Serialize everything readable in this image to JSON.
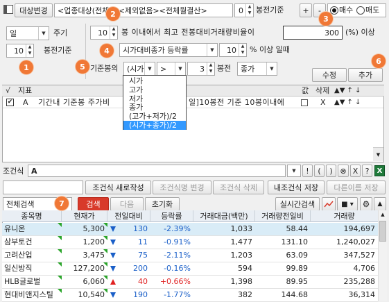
{
  "toolbar": {
    "target_change_label": "대상변경",
    "filter_text": "<업종대상(전체)><제외없음><전체월결산>",
    "bong_value": "0",
    "bong_label": "봉전기준",
    "plus_label": "+",
    "minus_label": "-",
    "buy_label": "매수",
    "sell_label": "매도",
    "side_selected": "buy"
  },
  "left_panel": {
    "period_value": "일",
    "period_label": "주기",
    "base_value": "10",
    "base_label": "봉전기준"
  },
  "condition": {
    "bong_count": "10",
    "line1_text": "봉 이내에서 최고 전봉대비거래량비율이",
    "ratio_value": "300",
    "ratio_unit": "(%) 이상",
    "compare_select": "시가대비종가 등락률",
    "pct_value": "10",
    "pct_label": "% 이상 일때",
    "base_bong_label": "기준봉의",
    "base_bong_select": "(시가",
    "op_select": ">",
    "bong_num": "3",
    "bong_suffix": "봉전",
    "price_select": "종가"
  },
  "dropdown": {
    "options": [
      "시가",
      "고가",
      "저가",
      "종가",
      "(고가+저가)/2",
      "(시가+종가)/2"
    ],
    "highlighted_index": 5
  },
  "actions": {
    "modify_label": "수정",
    "add_label": "추가"
  },
  "grid": {
    "headers": [
      "√",
      "지표",
      "값",
      "삭제"
    ],
    "row": {
      "key": "A",
      "text": "기간내 기준봉 주가비",
      "text_tail": "일]10봉전 기준 10봉이내에",
      "value_mark": "X"
    }
  },
  "formula": {
    "label": "조건식",
    "value": "A",
    "ops": [
      "!",
      "(",
      ")",
      "⊗",
      "X",
      "?"
    ]
  },
  "bottom_buttons": {
    "new_label": "조건식 새로작성",
    "rename_label": "조건식명 변경",
    "delete_label": "조건식 삭제",
    "my_save_label": "내조건식 저장",
    "save_as_label": "다른이름 저장"
  },
  "search_bar": {
    "scope_value": "전체검색",
    "search_label": "검색",
    "next_label": "다음",
    "reset_label": "초기화",
    "realtime_label": "실시간검색"
  },
  "badges": [
    "1",
    "2",
    "3",
    "4",
    "5",
    "6",
    "7"
  ],
  "results": {
    "headers": [
      "종목명",
      "현재가",
      "전일대비",
      "등락률",
      "거래대금(백만)",
      "거래량전일비",
      "거래량"
    ],
    "rows": [
      {
        "name": "유니온",
        "price": "5,300",
        "dir": "down",
        "change": "130",
        "rate": "-2.39%",
        "amount": "1,033",
        "vol_ratio": "58.44",
        "volume": "194,697"
      },
      {
        "name": "삼부토건",
        "price": "1,200",
        "dir": "down",
        "change": "11",
        "rate": "-0.91%",
        "amount": "1,477",
        "vol_ratio": "131.10",
        "volume": "1,240,027"
      },
      {
        "name": "고려산업",
        "price": "3,475",
        "dir": "down",
        "change": "75",
        "rate": "-2.11%",
        "amount": "1,203",
        "vol_ratio": "63.09",
        "volume": "347,527"
      },
      {
        "name": "일신방직",
        "price": "127,200",
        "dir": "down",
        "change": "200",
        "rate": "-0.16%",
        "amount": "594",
        "vol_ratio": "99.89",
        "volume": "4,706"
      },
      {
        "name": "HLB글로벌",
        "price": "6,060",
        "dir": "up",
        "change": "40",
        "rate": "+0.66%",
        "amount": "1,398",
        "vol_ratio": "89.95",
        "volume": "235,288"
      },
      {
        "name": "현대비앤지스틸",
        "price": "10,540",
        "dir": "down",
        "change": "190",
        "rate": "-1.77%",
        "amount": "382",
        "vol_ratio": "144.68",
        "volume": "36,314"
      }
    ]
  },
  "colors": {
    "accent_orange": "#f07836",
    "search_red": "#d83a2a",
    "up_red": "#e02020",
    "down_blue": "#1a5fc8",
    "highlight_blue": "#3399ff"
  }
}
